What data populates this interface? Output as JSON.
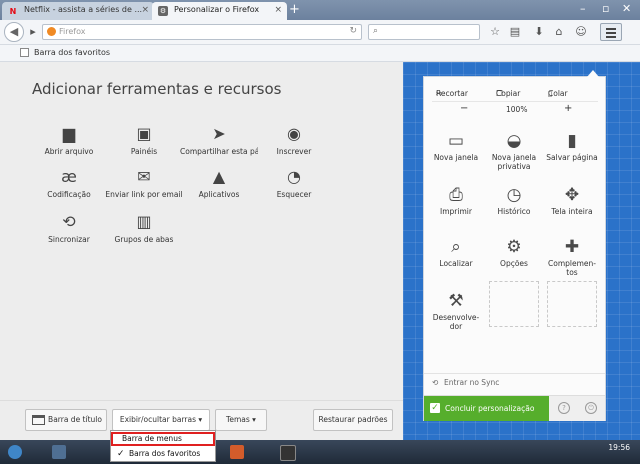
{
  "tabs": [
    {
      "title": "Netflix - assista a séries de ...",
      "favicon": "N"
    },
    {
      "title": "Personalizar o Firefox",
      "favicon": "gear"
    }
  ],
  "urlbar": {
    "placeholder": "Firefox"
  },
  "bookmarks_bar": {
    "label": "Barra dos favoritos"
  },
  "palette": {
    "title": "Adicionar ferramentas e recursos",
    "items": [
      {
        "label": "Abrir arquivo",
        "icon": "folder-icon"
      },
      {
        "label": "Painéis",
        "icon": "panels-icon"
      },
      {
        "label": "Compartilhar esta pá...",
        "icon": "share-icon"
      },
      {
        "label": "Inscrever",
        "icon": "rss-icon"
      },
      {
        "label": "Codificação",
        "icon": "encoding-icon"
      },
      {
        "label": "Enviar link por email",
        "icon": "email-icon"
      },
      {
        "label": "Aplicativos",
        "icon": "rocket-icon"
      },
      {
        "label": "Esquecer",
        "icon": "forget-icon"
      },
      {
        "label": "Sincronizar",
        "icon": "sync-icon"
      },
      {
        "label": "Grupos de abas",
        "icon": "tab-groups-icon"
      }
    ]
  },
  "bottom_buttons": {
    "titlebar": "Barra de título",
    "toolbars": "Exibir/ocultar barras",
    "themes": "Temas",
    "restore": "Restaurar padrões"
  },
  "menu_panel": {
    "cut": "Recortar",
    "copy": "Copiar",
    "paste": "Colar",
    "zoom_out": "−",
    "zoom": "100%",
    "zoom_in": "+",
    "tiles": [
      {
        "label": "Nova janela",
        "icon": "new-window-icon"
      },
      {
        "label": "Nova janela privativa",
        "icon": "private-window-icon"
      },
      {
        "label": "Salvar página",
        "icon": "save-page-icon"
      },
      {
        "label": "Imprimir",
        "icon": "print-icon"
      },
      {
        "label": "Histórico",
        "icon": "history-icon"
      },
      {
        "label": "Tela inteira",
        "icon": "fullscreen-icon"
      },
      {
        "label": "Localizar",
        "icon": "find-icon"
      },
      {
        "label": "Opções",
        "icon": "options-icon"
      },
      {
        "label": "Complemen-tos",
        "icon": "addons-icon"
      },
      {
        "label": "Desenvolve-dor",
        "icon": "developer-icon"
      }
    ],
    "sync": "Entrar no Sync",
    "exit": "Concluir personalização"
  },
  "dropdown": {
    "menubar": "Barra de menus",
    "favbar": "Barra dos favoritos",
    "favbar_checked": "✓"
  },
  "taskbar": {
    "clock": "19:56"
  },
  "colors": {
    "accent": "#2b72c9",
    "exit_green": "#56ae2c",
    "highlight_red": "#e02020"
  }
}
